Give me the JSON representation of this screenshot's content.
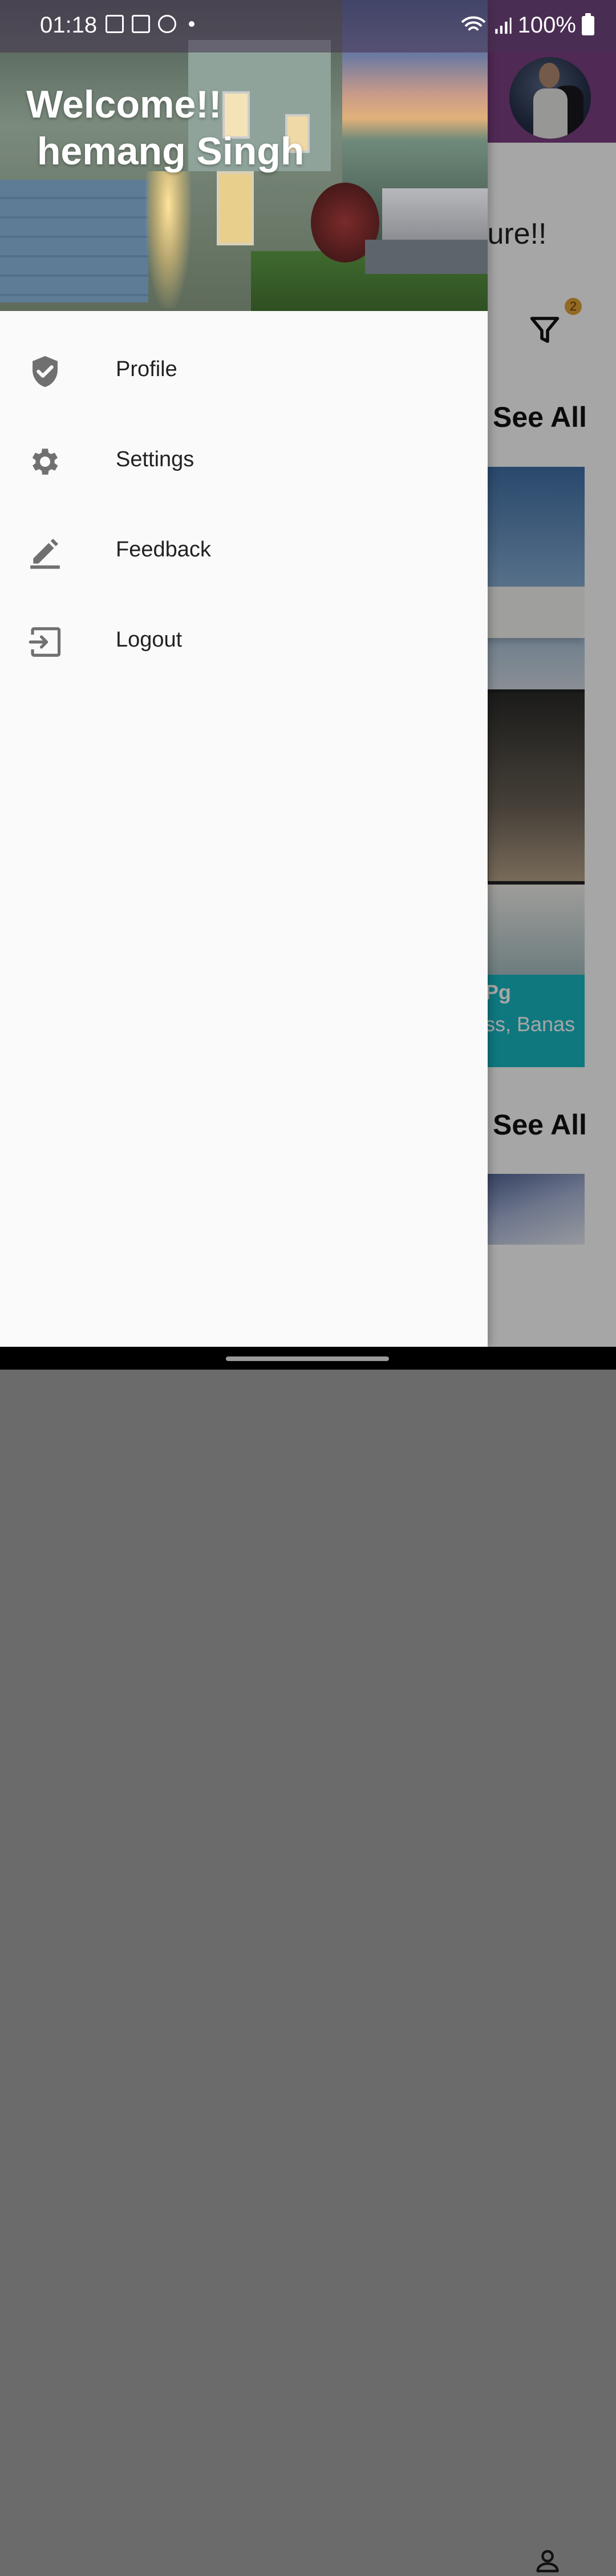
{
  "status_bar": {
    "time": "01:18",
    "battery": "100%",
    "left_icons": [
      "gallery-icon",
      "voicemail-icon",
      "facebook-icon",
      "dot-icon"
    ],
    "right_icons": [
      "wifi-calling-icon",
      "signal-icon",
      "battery-icon"
    ]
  },
  "drawer": {
    "welcome_text": "Welcome!!\n hemang Singh",
    "items": [
      {
        "label": "Profile",
        "icon": "shield-check-icon"
      },
      {
        "label": "Settings",
        "icon": "gear-icon"
      },
      {
        "label": "Feedback",
        "icon": "edit-icon"
      },
      {
        "label": "Logout",
        "icon": "logout-icon"
      }
    ]
  },
  "background": {
    "heading_partial": "ture!!",
    "filter_badge": "2",
    "see_all_1": "See All",
    "see_all_2": "See All",
    "card_title_partial": "Pg",
    "card_location_partial": "ss, Banas"
  },
  "colors": {
    "app_bar": "#7d3f83",
    "drawer_bg": "#fafafa",
    "icon_gray": "#707070"
  }
}
